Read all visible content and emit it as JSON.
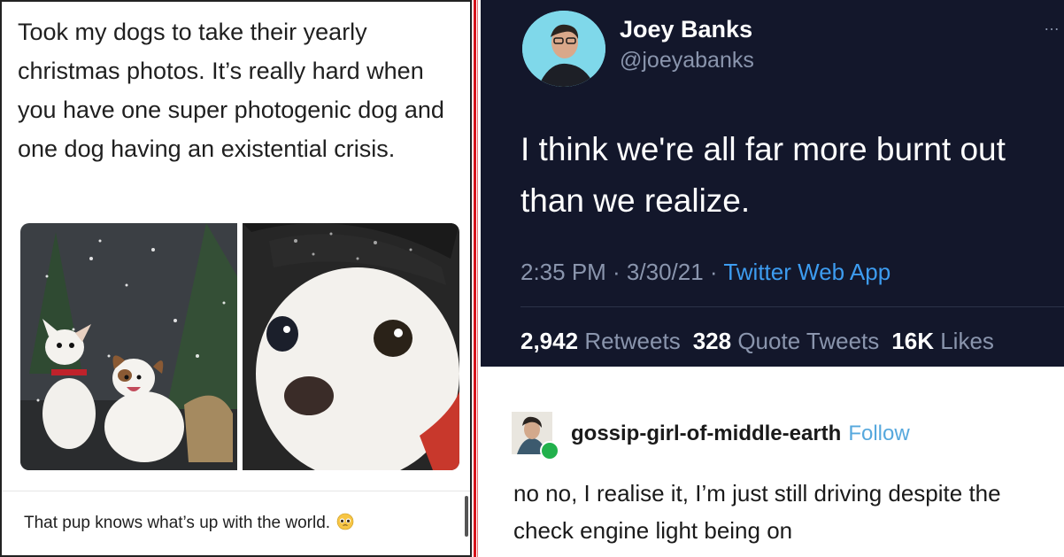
{
  "left_post": {
    "text": "Took my dogs to take their yearly christmas photos. It’s really hard when you have one super photogenic dog and one dog having an existential crisis.",
    "caption": "That pup knows what’s up with the world."
  },
  "tweet": {
    "display_name": "Joey Banks",
    "handle": "@joeyabanks",
    "more_icon": "…",
    "body": "I think we're all far more burnt out than we realize.",
    "timestamp": "2:35 PM · 3/30/21 · ",
    "app": "Twitter Web App",
    "stats": {
      "retweets_count": "2,942",
      "retweets_label": "Retweets",
      "quotes_count": "328",
      "quotes_label": "Quote Tweets",
      "likes_count": "16K",
      "likes_label": "Likes"
    }
  },
  "tumblr_reply": {
    "username": "gossip-girl-of-middle-earth",
    "follow_label": "Follow",
    "text": "no no, I realise it, I’m just still driving despite the check engine light being on"
  },
  "colors": {
    "separator": "#d6131b",
    "tweet_bg": "#13172b",
    "link": "#3d9cf0",
    "follow": "#56a8dd"
  }
}
